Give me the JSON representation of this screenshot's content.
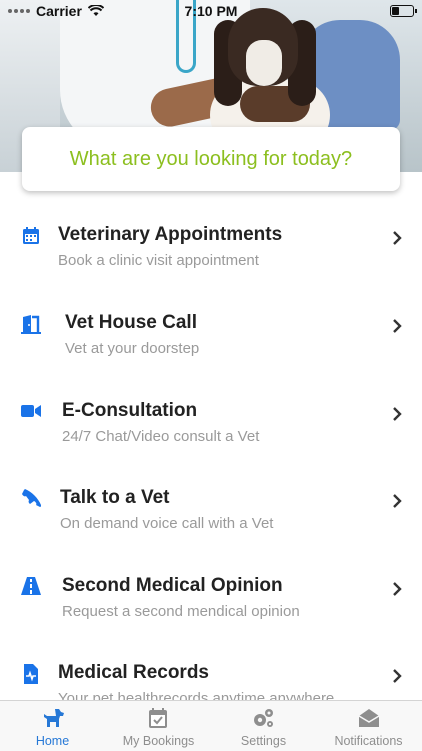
{
  "status_bar": {
    "carrier": "Carrier",
    "time": "7:10 PM"
  },
  "prompt": {
    "text": "What are you looking for today?"
  },
  "menu": {
    "items": [
      {
        "title": "Veterinary Appointments",
        "subtitle": "Book a clinic visit appointment",
        "icon": "calendar-icon"
      },
      {
        "title": "Vet House Call",
        "subtitle": "Vet at your doorstep",
        "icon": "door-icon"
      },
      {
        "title": "E-Consultation",
        "subtitle": "24/7 Chat/Video consult a Vet",
        "icon": "video-camera-icon"
      },
      {
        "title": "Talk to a Vet",
        "subtitle": "On demand voice call with a Vet",
        "icon": "phone-icon"
      },
      {
        "title": "Second Medical Opinion",
        "subtitle": "Request a second mendical opinion",
        "icon": "road-icon"
      },
      {
        "title": "Medical Records",
        "subtitle": "Your pet healthrecords anytime anywhere",
        "icon": "medical-file-icon"
      }
    ]
  },
  "tabbar": {
    "tabs": [
      {
        "label": "Home",
        "icon": "dog-icon",
        "active": true
      },
      {
        "label": "My Bookings",
        "icon": "calendar-check-icon",
        "active": false
      },
      {
        "label": "Settings",
        "icon": "gears-icon",
        "active": false
      },
      {
        "label": "Notifications",
        "icon": "envelope-icon",
        "active": false
      }
    ]
  },
  "colors": {
    "accent": "#2678d6",
    "prompt_text": "#8cbf1f",
    "icon_blue": "#1a73e8"
  }
}
